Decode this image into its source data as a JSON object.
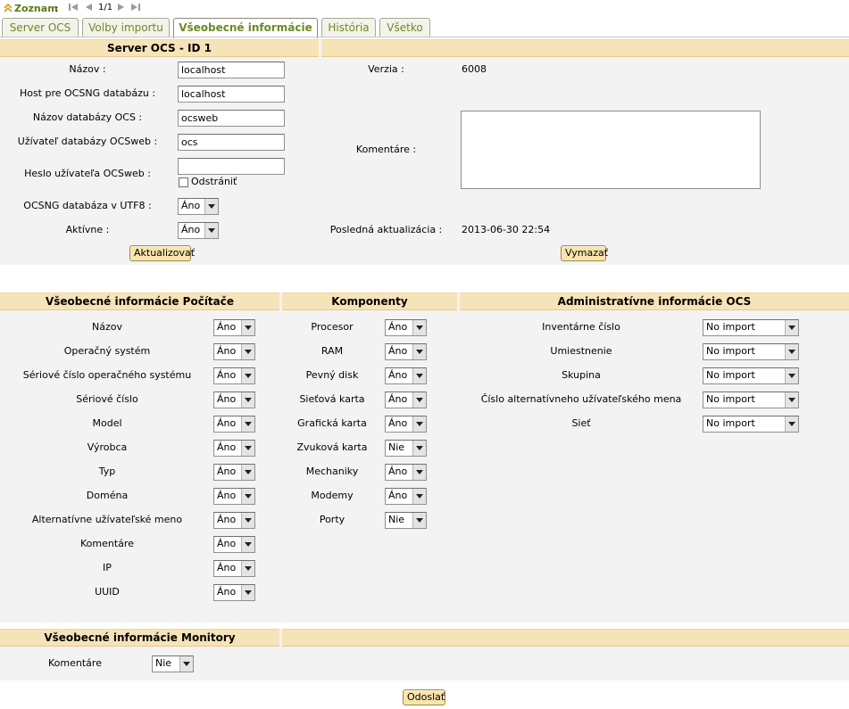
{
  "nav": {
    "list_link": "Zoznam",
    "colon": ":",
    "page_count": "1/1"
  },
  "tabs": [
    {
      "label": "Server OCS"
    },
    {
      "label": "Volby importu"
    },
    {
      "label": "Všeobecné informácie"
    },
    {
      "label": "História"
    },
    {
      "label": "Všetko"
    }
  ],
  "server": {
    "header": "Server OCS - ID 1",
    "fields": {
      "name_label": "Názov :",
      "name_value": "localhost",
      "host_label": "Host pre OCSNG databázu :",
      "host_value": "localhost",
      "dbname_label": "Názov databázy OCS :",
      "dbname_value": "ocsweb",
      "dbuser_label": "Užívateľ databázy OCSweb :",
      "dbuser_value": "ocs",
      "password_label": "Heslo užívateľa OCSweb :",
      "password_value": "",
      "remove_label": "Odstrániť",
      "utf8_label": "OCSNG databáza v UTF8 :",
      "utf8_value": "Áno",
      "active_label": "Aktívne :",
      "active_value": "Áno",
      "version_label": "Verzia :",
      "version_value": "6008",
      "comments_label": "Komentáre :",
      "lastupdate_label": "Posledná aktualizácia :",
      "lastupdate_value": "2013-06-30 22:54"
    },
    "update_button": "Aktualizovať",
    "delete_button": "Vymazať"
  },
  "computer": {
    "header": "Všeobecné informácie Počítače",
    "rows": [
      {
        "label": "Názov",
        "value": "Áno"
      },
      {
        "label": "Operačný systém",
        "value": "Áno"
      },
      {
        "label": "Sériové číslo operačného systému",
        "value": "Áno"
      },
      {
        "label": "Sériové číslo",
        "value": "Áno"
      },
      {
        "label": "Model",
        "value": "Áno"
      },
      {
        "label": "Výrobca",
        "value": "Áno"
      },
      {
        "label": "Typ",
        "value": "Áno"
      },
      {
        "label": "Doména",
        "value": "Áno"
      },
      {
        "label": "Alternatívne užívateľské meno",
        "value": "Áno"
      },
      {
        "label": "Komentáre",
        "value": "Áno"
      },
      {
        "label": "IP",
        "value": "Áno"
      },
      {
        "label": "UUID",
        "value": "Áno"
      }
    ]
  },
  "components": {
    "header": "Komponenty",
    "rows": [
      {
        "label": "Procesor",
        "value": "Áno"
      },
      {
        "label": "RAM",
        "value": "Áno"
      },
      {
        "label": "Pevný disk",
        "value": "Áno"
      },
      {
        "label": "Sieťová karta",
        "value": "Áno"
      },
      {
        "label": "Grafická karta",
        "value": "Áno"
      },
      {
        "label": "Zvuková karta",
        "value": "Nie"
      },
      {
        "label": "Mechaniky",
        "value": "Áno"
      },
      {
        "label": "Modemy",
        "value": "Áno"
      },
      {
        "label": "Porty",
        "value": "Nie"
      }
    ]
  },
  "admin": {
    "header": "Administratívne informácie OCS",
    "rows": [
      {
        "label": "Inventárne číslo",
        "value": "No import"
      },
      {
        "label": "Umiestnenie",
        "value": "No import"
      },
      {
        "label": "Skupina",
        "value": "No import"
      },
      {
        "label": "Číslo alternatívneho užívateľského mena",
        "value": "No import"
      },
      {
        "label": "Sieť",
        "value": "No import"
      }
    ]
  },
  "monitor": {
    "header": "Všeobecné informácie Monitory",
    "rows": [
      {
        "label": "Komentáre",
        "value": "Nie"
      }
    ]
  },
  "submit_button": "Odoslať",
  "colors": {
    "header_bg": "#f7e3b8",
    "panel_bg": "#f3f3f3",
    "tab_text": "#6d8a24",
    "button_bg": "#f9e4ac"
  }
}
